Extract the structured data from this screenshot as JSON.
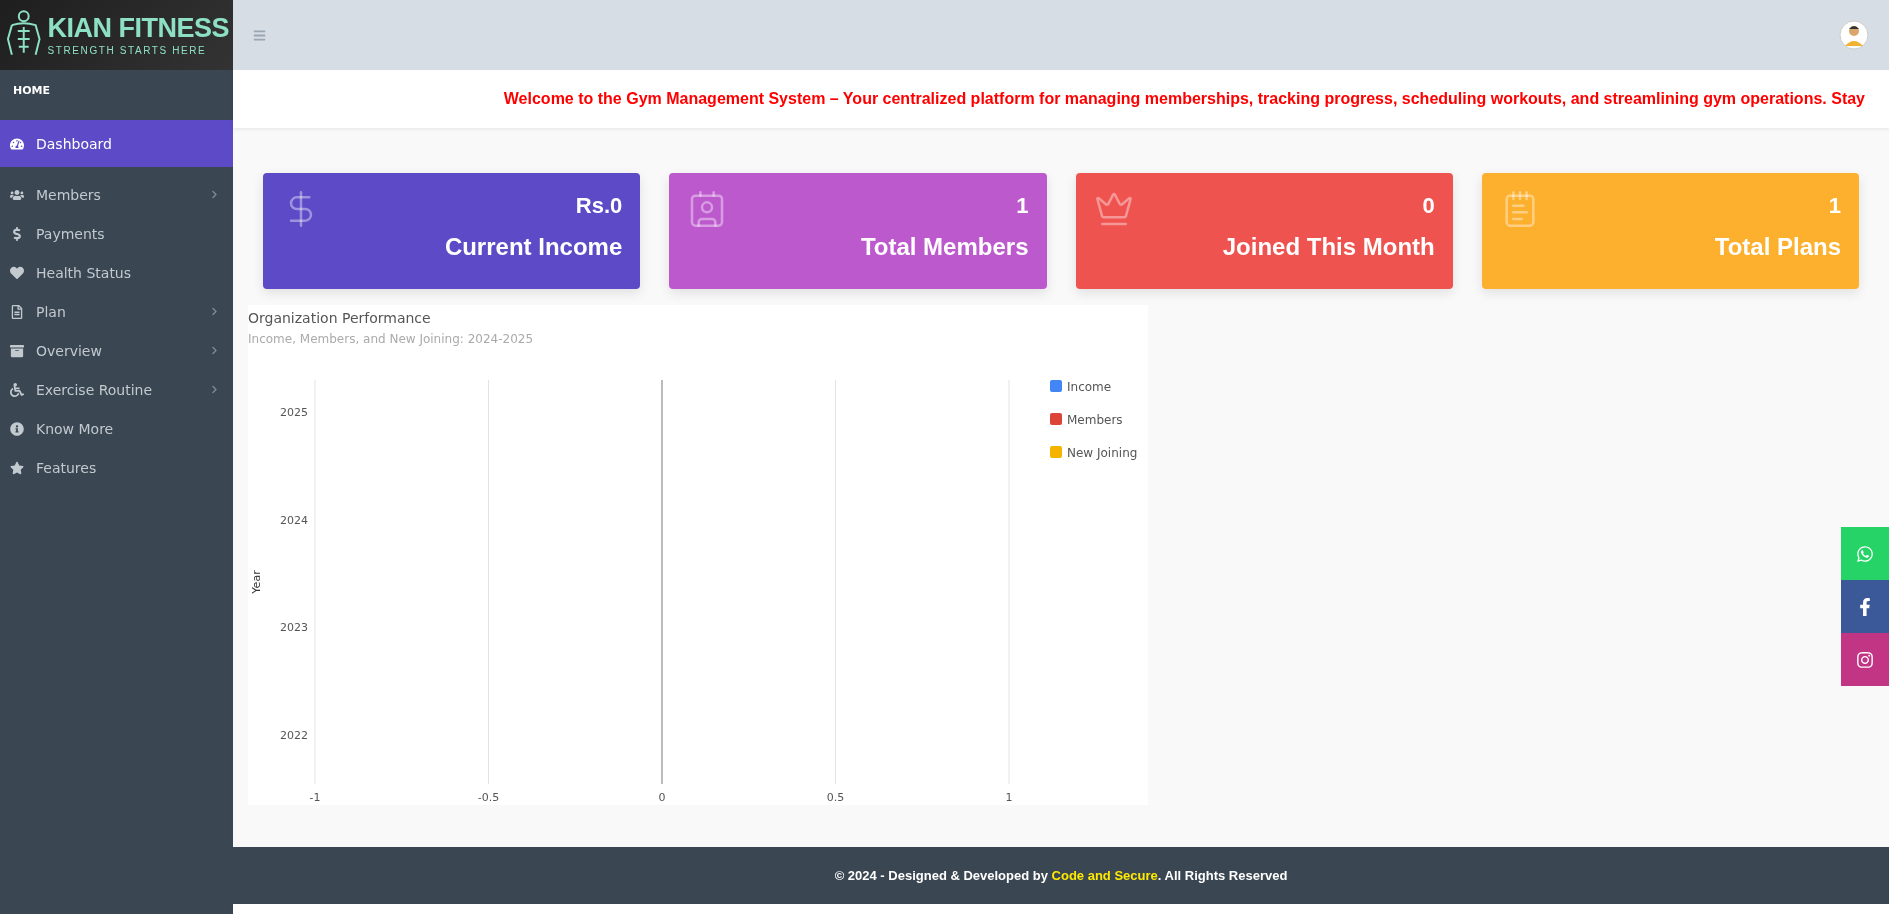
{
  "logo": {
    "title": "KIAN FITNESS",
    "tagline": "STRENGTH STARTS HERE"
  },
  "sidebar": {
    "heading": "HOME",
    "items": [
      {
        "label": "Dashboard",
        "selected": true,
        "submenu": false
      },
      {
        "label": "Members",
        "selected": false,
        "submenu": true
      },
      {
        "label": "Payments",
        "selected": false,
        "submenu": false
      },
      {
        "label": "Health Status",
        "selected": false,
        "submenu": false
      },
      {
        "label": "Plan",
        "selected": false,
        "submenu": true
      },
      {
        "label": "Overview",
        "selected": false,
        "submenu": true
      },
      {
        "label": "Exercise Routine",
        "selected": false,
        "submenu": true
      },
      {
        "label": "Know More",
        "selected": false,
        "submenu": false
      },
      {
        "label": "Features",
        "selected": false,
        "submenu": false
      }
    ]
  },
  "marquee": "Welcome to the Gym Management System – Your centralized platform for managing memberships, tracking progress, scheduling workouts, and streamlining gym operations. Stay",
  "cards": [
    {
      "value": "Rs.0",
      "label": "Current Income",
      "color": "#5c4ac6"
    },
    {
      "value": "1",
      "label": "Total Members",
      "color": "#bc5acd"
    },
    {
      "value": "0",
      "label": "Joined This Month",
      "color": "#ef5350"
    },
    {
      "value": "1",
      "label": "Total Plans",
      "color": "#fdb02d"
    }
  ],
  "performance": {
    "chart_data": {
      "type": "bar",
      "orientation": "horizontal",
      "title": "Organization Performance",
      "subtitle": "Income, Members, and New Joining: 2024-2025",
      "ylabel": "Year",
      "categories": [
        "2025",
        "2024",
        "2023",
        "2022"
      ],
      "series": [
        {
          "name": "Income",
          "color": "#4285f4",
          "values": [
            null,
            null,
            null,
            null
          ]
        },
        {
          "name": "Members",
          "color": "#db4437",
          "values": [
            null,
            null,
            null,
            null
          ]
        },
        {
          "name": "New Joining",
          "color": "#f4b400",
          "values": [
            null,
            null,
            null,
            null
          ]
        }
      ],
      "xlim": [
        -1,
        1
      ],
      "xticks": [
        {
          "value": -1,
          "label": "-1"
        },
        {
          "value": -0.5,
          "label": "-0.5"
        },
        {
          "value": 0,
          "label": "0"
        },
        {
          "value": 0.5,
          "label": "0.5"
        },
        {
          "value": 1,
          "label": "1"
        }
      ]
    }
  },
  "footer": {
    "before": "© 2024 - Designed & Developed by ",
    "link": "Code and Secure",
    "after": ". All Rights Reserved"
  }
}
